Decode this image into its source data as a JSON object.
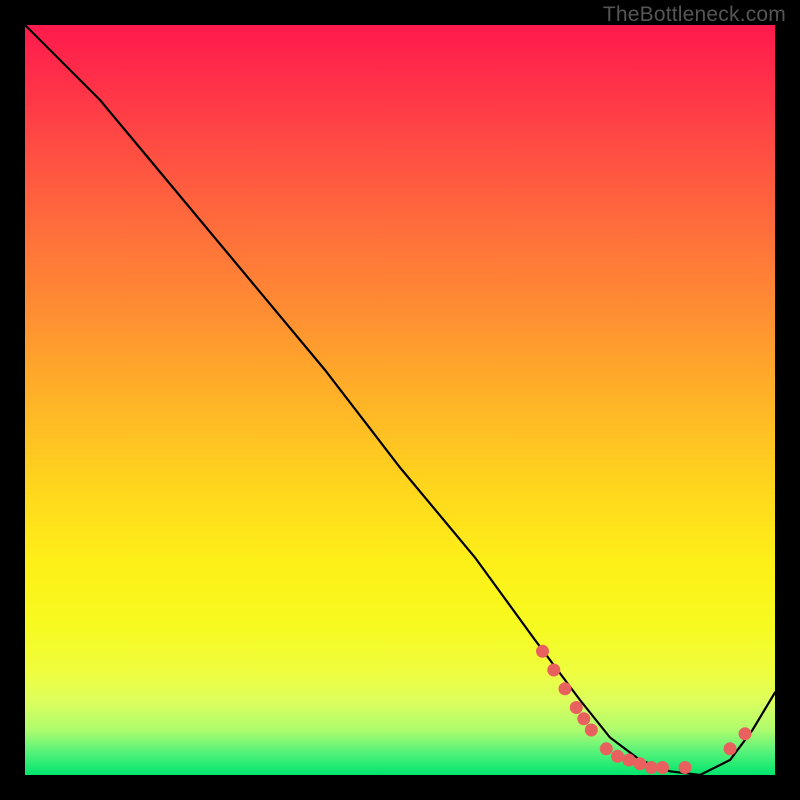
{
  "attribution": "TheBottleneck.com",
  "chart_data": {
    "type": "line",
    "title": "",
    "xlabel": "",
    "ylabel": "",
    "xlim": [
      0,
      100
    ],
    "ylim": [
      0,
      100
    ],
    "series": [
      {
        "name": "bottleneck-curve",
        "x": [
          0,
          6,
          10,
          20,
          30,
          40,
          50,
          60,
          68,
          74,
          78,
          82,
          86,
          90,
          94,
          97,
          100
        ],
        "y": [
          100,
          94,
          90,
          78,
          66,
          54,
          41,
          29,
          18,
          10,
          5,
          2,
          0.5,
          0,
          2,
          6,
          11
        ]
      }
    ],
    "markers": {
      "name": "data-points",
      "color": "#e9615f",
      "points": [
        {
          "x": 69.0,
          "y": 16.5
        },
        {
          "x": 70.5,
          "y": 14.0
        },
        {
          "x": 72.0,
          "y": 11.5
        },
        {
          "x": 73.5,
          "y": 9.0
        },
        {
          "x": 74.5,
          "y": 7.5
        },
        {
          "x": 75.5,
          "y": 6.0
        },
        {
          "x": 77.5,
          "y": 3.5
        },
        {
          "x": 79.0,
          "y": 2.5
        },
        {
          "x": 80.5,
          "y": 2.0
        },
        {
          "x": 82.0,
          "y": 1.5
        },
        {
          "x": 83.5,
          "y": 1.0
        },
        {
          "x": 85.0,
          "y": 1.0
        },
        {
          "x": 88.0,
          "y": 1.0
        },
        {
          "x": 94.0,
          "y": 3.5
        },
        {
          "x": 96.0,
          "y": 5.5
        }
      ]
    }
  }
}
